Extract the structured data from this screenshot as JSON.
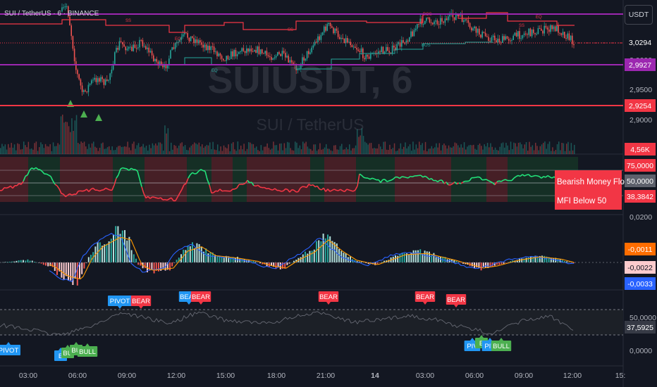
{
  "symbol_title": "SUI / TetherUS · 6 · BINANCE",
  "watermark": {
    "ticker": "SUIUSDT, 6",
    "name": "SUI / TetherUS"
  },
  "currency_button": "USDT",
  "price_axis": {
    "ticks": [
      "3,0000",
      "2,9500",
      "2,9000"
    ],
    "badges": {
      "last": {
        "text": "3,0294",
        "color": "#131722"
      },
      "upper": {
        "text": "2,9927",
        "color": "#9c27b0"
      },
      "lower": {
        "text": "2,9254",
        "color": "#f23645"
      },
      "volume": {
        "text": "4,56K",
        "color": "#f23645"
      }
    }
  },
  "mfi_axis": {
    "badges": {
      "upper": {
        "text": "75,0000",
        "color": "#f23645"
      },
      "mid": {
        "text": "50,0000",
        "color": "#5d606b"
      },
      "value": {
        "text": "38,3842",
        "color": "#f23645"
      }
    },
    "tick": "0,0200",
    "labels": {
      "line1": "Bearish Money Flow",
      "line2": "MFI Below 50"
    }
  },
  "macd_axis": {
    "badges": {
      "signal": {
        "text": "-0,0011",
        "color": "#ff6d00"
      },
      "hist": {
        "text": "-0,0022",
        "color": "#fccbcd"
      },
      "macd": {
        "text": "-0,0033",
        "color": "#2962ff"
      }
    }
  },
  "rsi_axis": {
    "ticks": [
      "50,0000",
      "0,0000"
    ],
    "badge": {
      "text": "37,5925",
      "color": "#363a45"
    }
  },
  "time_axis": [
    "03:00",
    "06:00",
    "09:00",
    "12:00",
    "15:00",
    "18:00",
    "21:00",
    "14",
    "03:00",
    "06:00",
    "09:00",
    "12:00",
    "15:"
  ],
  "chart_labels": {
    "ss": "SS",
    "eq": "EQ",
    "bos": "BOS",
    "bear_tag": "BEAR",
    "bull_tag": "BULL",
    "pivot_tag": "PIVOT",
    "pivot_short": "PIV",
    "bull_short": "BU",
    "bull_b": "B"
  },
  "colors": {
    "bull": "#26a69a",
    "bear": "#ef5350",
    "purple": "#9c27b0",
    "red_level": "#f23645",
    "mfi_line": "#22e37a",
    "macd_line": "#2962ff",
    "signal_line": "#ff9800",
    "pivot_blue": "#2196f3",
    "bull_green": "#4caf50",
    "grid": "#1e222d"
  }
}
